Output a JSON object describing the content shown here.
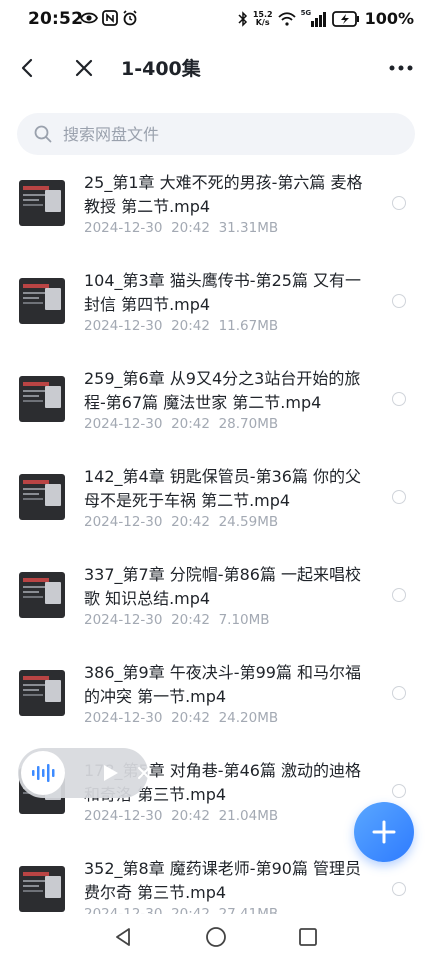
{
  "status_bar": {
    "time": "20:52",
    "net_speed_value": "15.2",
    "net_speed_unit": "K/s",
    "network_type": "5G",
    "battery_percent": "100%"
  },
  "header": {
    "title": "1-400集",
    "back_icon": "back-arrow-icon",
    "close_icon": "close-icon",
    "more_icon": "more-dots-icon"
  },
  "search": {
    "placeholder": "搜索网盘文件",
    "value": ""
  },
  "files": [
    {
      "name": "25_第1章 大难不死的男孩-第六篇 麦格教授 第二节.mp4",
      "date": "2024-12-30",
      "time": "20:42",
      "size": "31.31MB"
    },
    {
      "name": "104_第3章 猫头鹰传书-第25篇 又有一封信 第四节.mp4",
      "date": "2024-12-30",
      "time": "20:42",
      "size": "11.67MB"
    },
    {
      "name": "259_第6章 从9又4分之3站台开始的旅程-第67篇 魔法世家 第二节.mp4",
      "date": "2024-12-30",
      "time": "20:42",
      "size": "28.70MB"
    },
    {
      "name": "142_第4章 钥匙保管员-第36篇 你的父母不是死于车祸 第二节.mp4",
      "date": "2024-12-30",
      "time": "20:42",
      "size": "24.59MB"
    },
    {
      "name": "337_第7章 分院帽-第86篇 一起来唱校歌 知识总结.mp4",
      "date": "2024-12-30",
      "time": "20:42",
      "size": "7.10MB"
    },
    {
      "name": "386_第9章 午夜决斗-第99篇 和马尔福的冲突 第一节.mp4",
      "date": "2024-12-30",
      "time": "20:42",
      "size": "24.20MB"
    },
    {
      "name": "178_第5章 对角巷-第46篇 激动的迪格和奇洛 第三节.mp4",
      "date": "2024-12-30",
      "time": "20:42",
      "size": "21.04MB"
    },
    {
      "name": "352_第8章 魔药课老师-第90篇 管理员费尔奇 第三节.mp4",
      "date": "2024-12-30",
      "time": "20:42",
      "size": "27.41MB"
    }
  ],
  "floating_player": {
    "wave_icon": "audio-wave-icon",
    "play_icon": "play-icon",
    "close_icon": "close-icon"
  },
  "fab": {
    "icon": "plus-icon",
    "color": "#3d8bff"
  },
  "nav_bar": {
    "back_icon": "nav-back-icon",
    "home_icon": "nav-home-icon",
    "recent_icon": "nav-recent-icon"
  },
  "colors": {
    "accent": "#3d8bff",
    "meta_text": "#a3a9b3",
    "search_bg": "#f2f4f8"
  }
}
